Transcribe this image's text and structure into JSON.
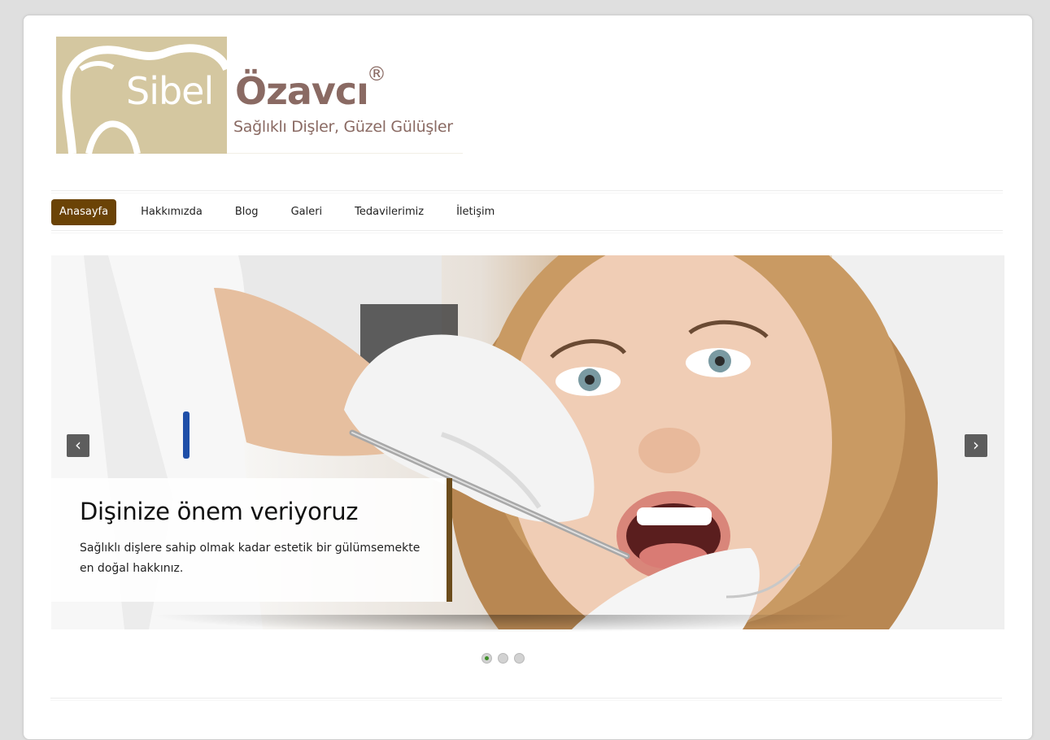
{
  "logo": {
    "first_name": "Sibel",
    "last_name": "Özavcı",
    "registered": "®",
    "tagline": "Sağlıklı Dişler, Güzel Gülüşler"
  },
  "nav": {
    "items": [
      {
        "label": "Anasayfa",
        "active": true
      },
      {
        "label": "Hakkımızda"
      },
      {
        "label": "Blog"
      },
      {
        "label": "Galeri"
      },
      {
        "label": "Tedavilerimiz"
      },
      {
        "label": "İletişim"
      }
    ]
  },
  "slider": {
    "title": "Dişinize önem veriyoruz",
    "text": "Sağlıklı dişlere sahip olmak kadar estetik bir gülümsemekte en doğal hakkınız.",
    "prev_icon": "chevron-left-icon",
    "next_icon": "chevron-right-icon",
    "prev_glyph": "‹",
    "next_glyph": "›",
    "slide_count": 3,
    "active_slide": 1
  },
  "colors": {
    "accent": "#6b4306",
    "logo_gold": "#d4c7a0",
    "logo_mauve": "#8a6a63",
    "dot_active": "#3f8f2a"
  }
}
